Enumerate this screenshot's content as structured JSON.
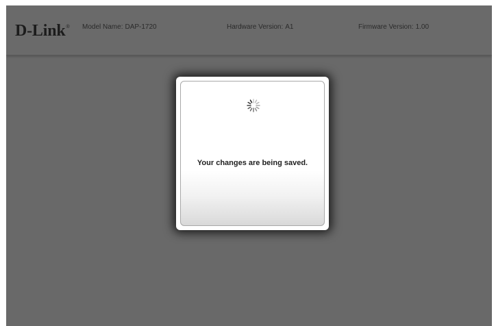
{
  "header": {
    "logo": "D-Link",
    "logo_mark": "®",
    "model_label": "Model Name:",
    "model_value": "DAP-1720",
    "hardware_label": "Hardware Version:",
    "hardware_value": "A1",
    "firmware_label": "Firmware Version:",
    "firmware_value": "1.00"
  },
  "modal": {
    "icon": "loading-spinner-icon",
    "message": "Your changes are being saved."
  },
  "colors": {
    "overlay": "#696969",
    "modal_bg": "#ffffff",
    "logo": "#1c1c1c"
  }
}
